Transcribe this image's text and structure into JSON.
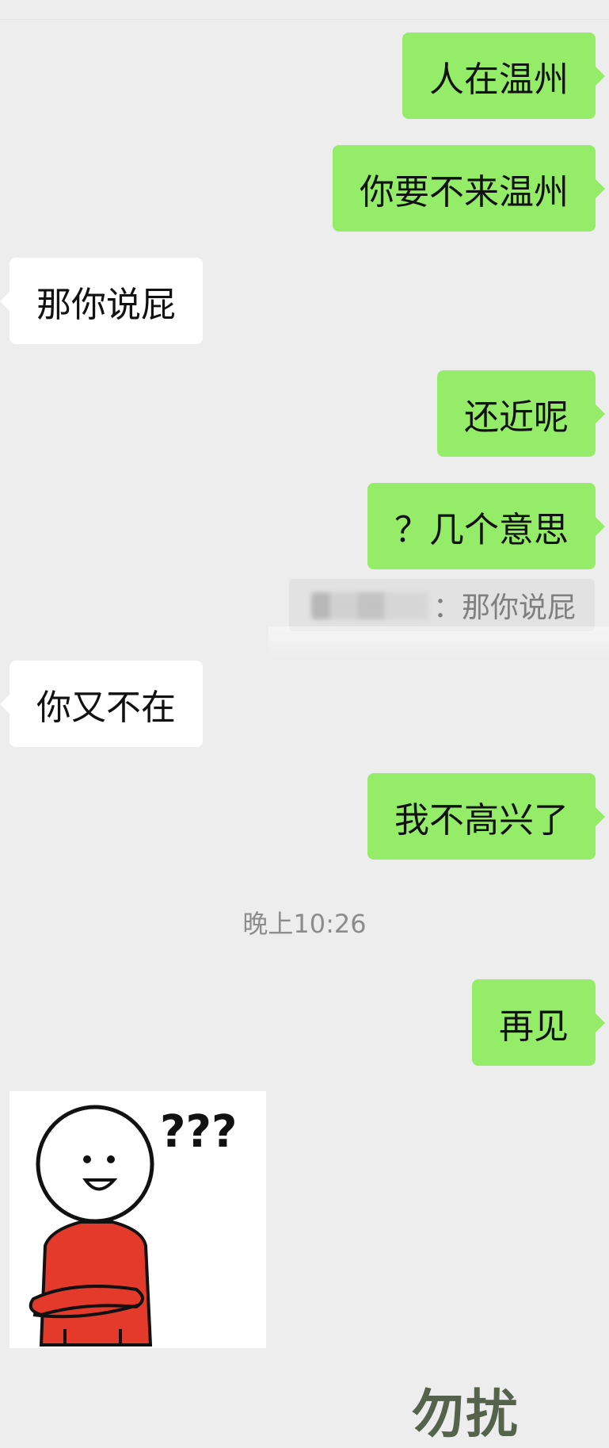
{
  "messages": [
    {
      "side": "me",
      "text": "人在温州"
    },
    {
      "side": "me",
      "text": "你要不来温州"
    },
    {
      "side": "other",
      "text": "那你说屁"
    },
    {
      "side": "me",
      "text": "还近呢"
    },
    {
      "side": "me",
      "text": "？几个意思"
    },
    {
      "side": "other",
      "text": "你又不在"
    },
    {
      "side": "me",
      "text": "我不高兴了"
    },
    {
      "side": "me",
      "text": "再见"
    }
  ],
  "quote": {
    "text": "：那你说屁"
  },
  "timestamp": "晚上10:26",
  "sticker": {
    "text": "???",
    "description": "smiling stick figure with question marks"
  },
  "watermark": "勿扰",
  "colors": {
    "background": "#ededed",
    "my_bubble": "#95ec69",
    "their_bubble": "#ffffff",
    "timestamp": "#8c8c8c"
  }
}
